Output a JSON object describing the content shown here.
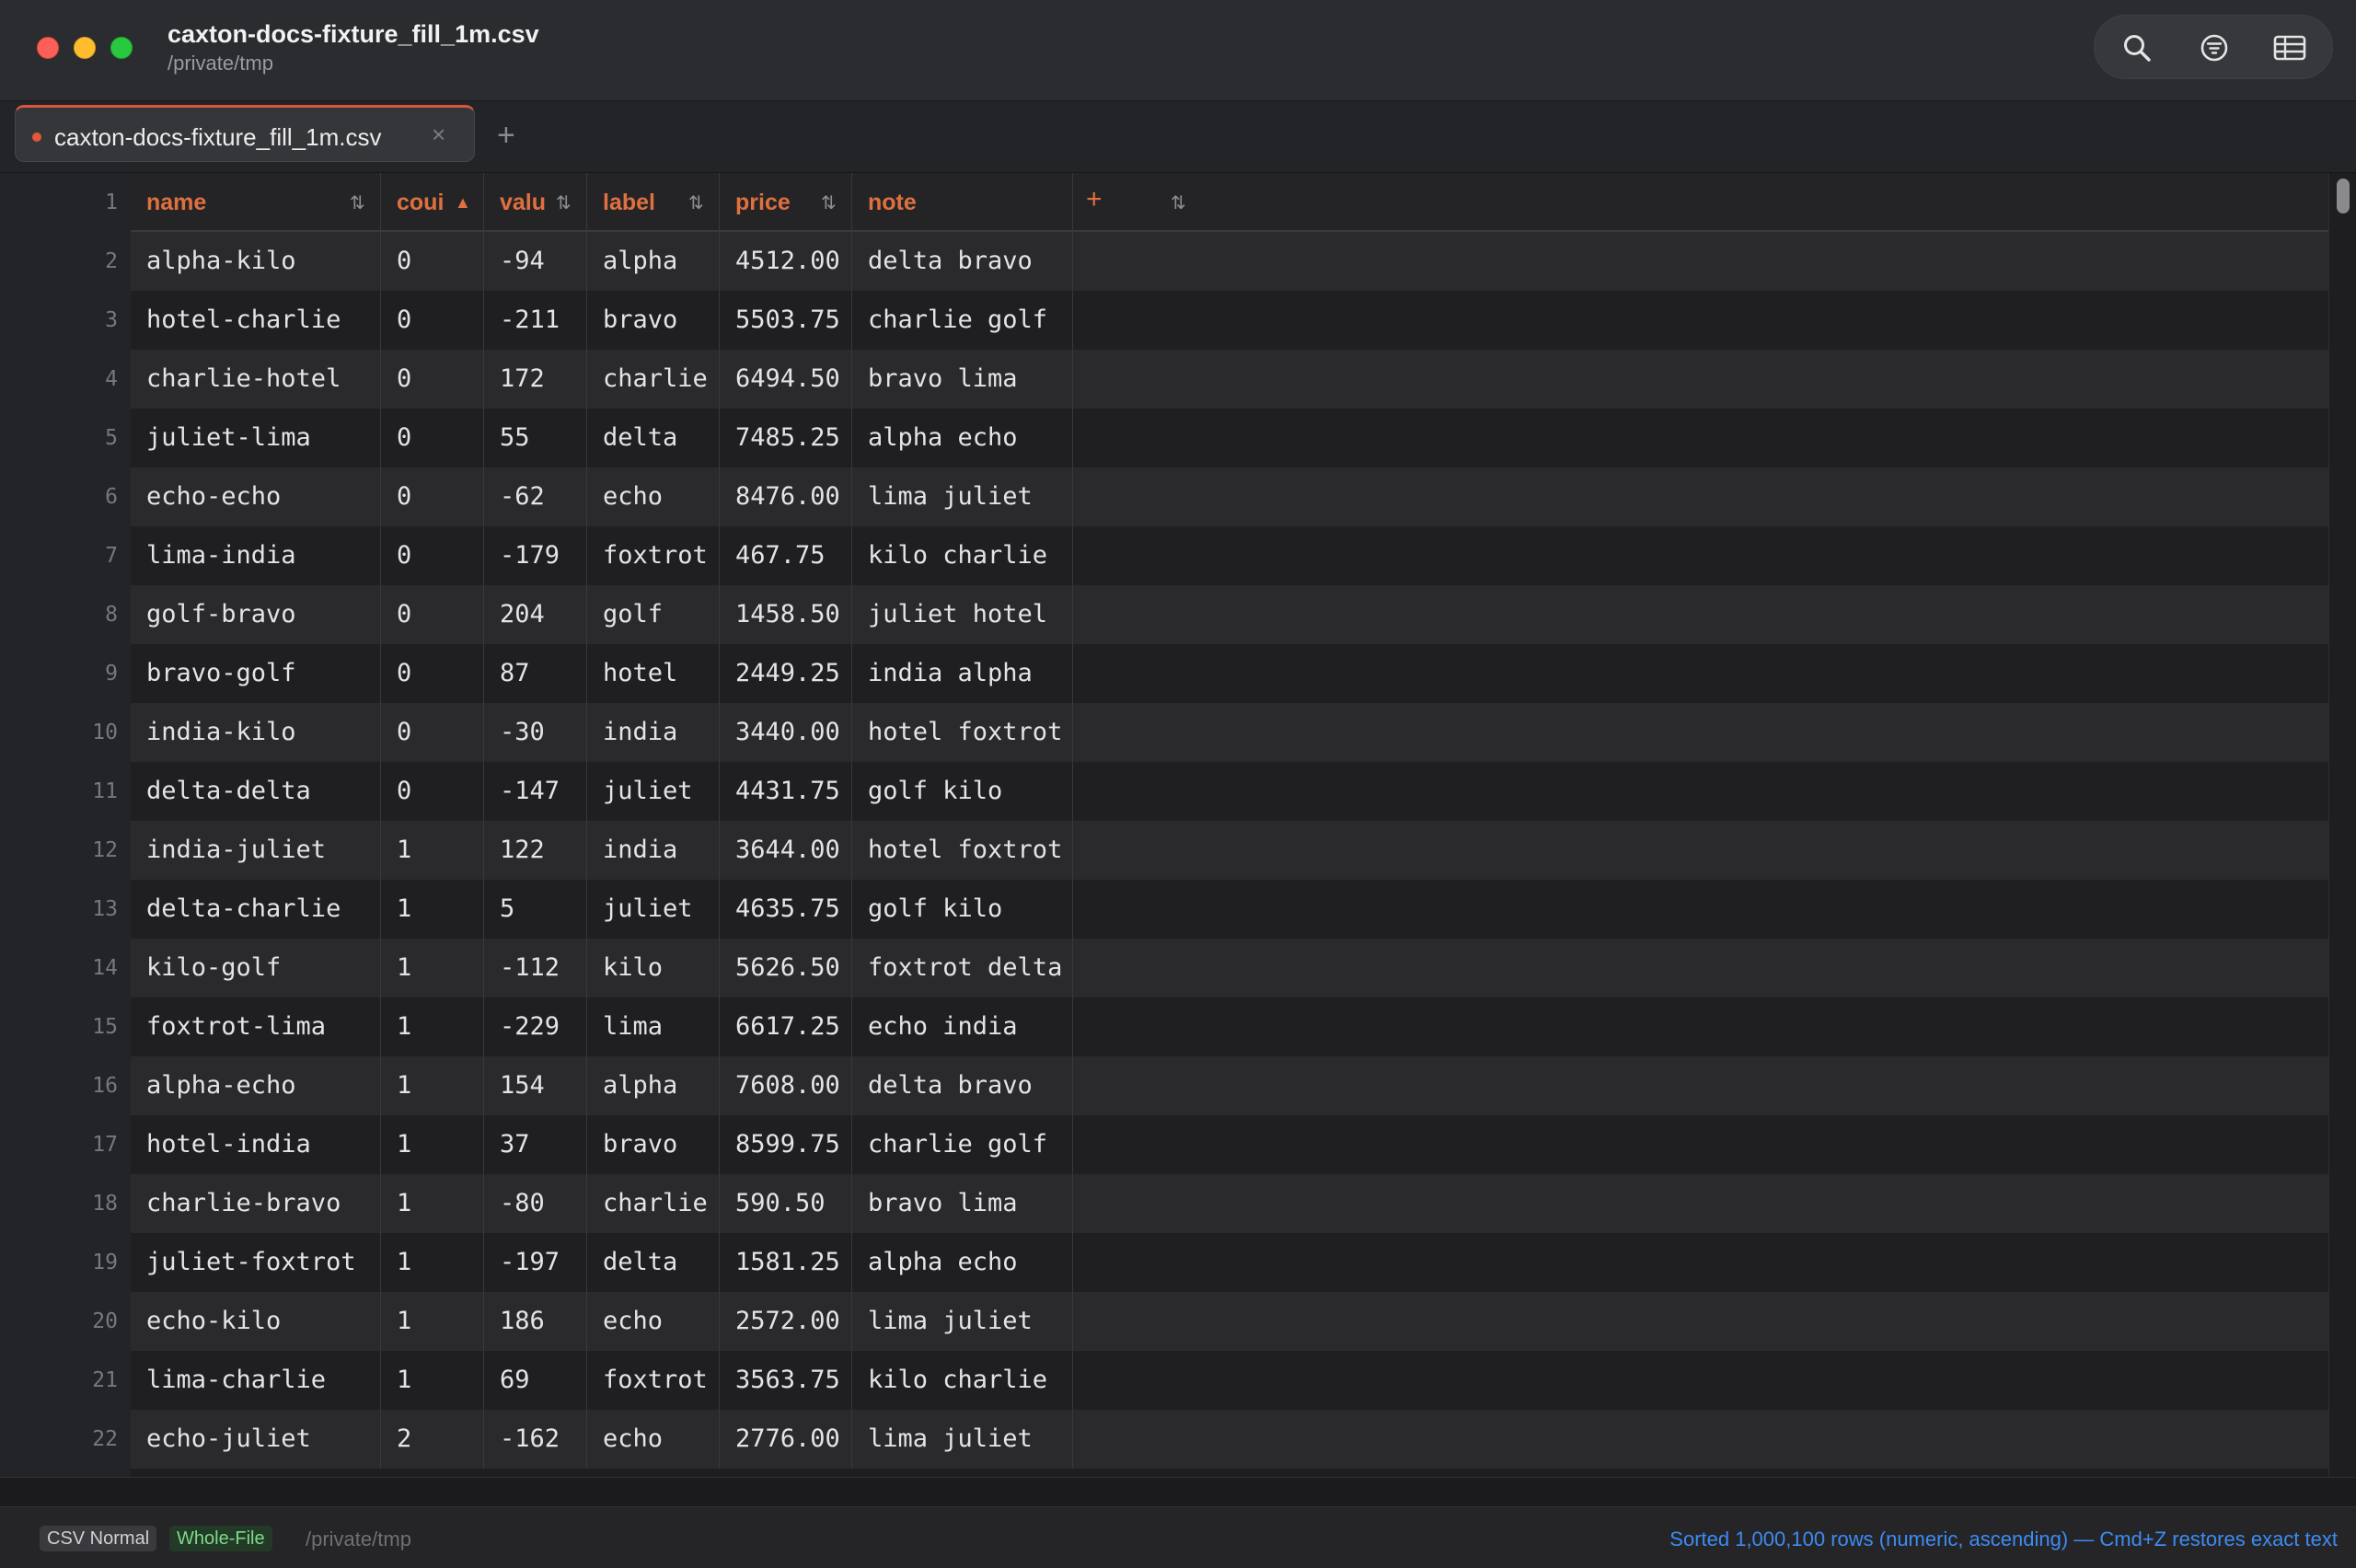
{
  "window": {
    "title": "caxton-docs-fixture_fill_1m.csv",
    "subtitle": "/private/tmp"
  },
  "toolbar": {
    "search_icon": "search-icon",
    "filter_icon": "filter-icon",
    "grid_icon": "table-grid-icon"
  },
  "tabs": [
    {
      "label": "caxton-docs-fixture_fill_1m.csv",
      "close": "×",
      "modified": true
    }
  ],
  "tab_add": "+",
  "column_add": "+",
  "columns": [
    {
      "label": "name",
      "sort": "⇅"
    },
    {
      "label": "coui",
      "sort": "▲"
    },
    {
      "label": "valu",
      "sort": "⇅"
    },
    {
      "label": "label",
      "sort": "⇅"
    },
    {
      "label": "price",
      "sort": "⇅"
    },
    {
      "label": "note",
      "sort": "⇅"
    }
  ],
  "header_row_number": "1",
  "rows": [
    {
      "n": "2",
      "cells": [
        "alpha-kilo",
        "0",
        "-94",
        "alpha",
        "4512.00",
        "delta bravo"
      ]
    },
    {
      "n": "3",
      "cells": [
        "hotel-charlie",
        "0",
        "-211",
        "bravo",
        "5503.75",
        "charlie golf"
      ]
    },
    {
      "n": "4",
      "cells": [
        "charlie-hotel",
        "0",
        "172",
        "charlie",
        "6494.50",
        "bravo lima"
      ]
    },
    {
      "n": "5",
      "cells": [
        "juliet-lima",
        "0",
        "55",
        "delta",
        "7485.25",
        "alpha echo"
      ]
    },
    {
      "n": "6",
      "cells": [
        "echo-echo",
        "0",
        "-62",
        "echo",
        "8476.00",
        "lima juliet"
      ]
    },
    {
      "n": "7",
      "cells": [
        "lima-india",
        "0",
        "-179",
        "foxtrot",
        "467.75",
        "kilo charlie"
      ]
    },
    {
      "n": "8",
      "cells": [
        "golf-bravo",
        "0",
        "204",
        "golf",
        "1458.50",
        "juliet hotel"
      ]
    },
    {
      "n": "9",
      "cells": [
        "bravo-golf",
        "0",
        "87",
        "hotel",
        "2449.25",
        "india alpha"
      ]
    },
    {
      "n": "10",
      "cells": [
        "india-kilo",
        "0",
        "-30",
        "india",
        "3440.00",
        "hotel foxtrot"
      ]
    },
    {
      "n": "11",
      "cells": [
        "delta-delta",
        "0",
        "-147",
        "juliet",
        "4431.75",
        "golf kilo"
      ]
    },
    {
      "n": "12",
      "cells": [
        "india-juliet",
        "1",
        "122",
        "india",
        "3644.00",
        "hotel foxtrot"
      ]
    },
    {
      "n": "13",
      "cells": [
        "delta-charlie",
        "1",
        "5",
        "juliet",
        "4635.75",
        "golf kilo"
      ]
    },
    {
      "n": "14",
      "cells": [
        "kilo-golf",
        "1",
        "-112",
        "kilo",
        "5626.50",
        "foxtrot delta"
      ]
    },
    {
      "n": "15",
      "cells": [
        "foxtrot-lima",
        "1",
        "-229",
        "lima",
        "6617.25",
        "echo india"
      ]
    },
    {
      "n": "16",
      "cells": [
        "alpha-echo",
        "1",
        "154",
        "alpha",
        "7608.00",
        "delta bravo"
      ]
    },
    {
      "n": "17",
      "cells": [
        "hotel-india",
        "1",
        "37",
        "bravo",
        "8599.75",
        "charlie golf"
      ]
    },
    {
      "n": "18",
      "cells": [
        "charlie-bravo",
        "1",
        "-80",
        "charlie",
        "590.50",
        "bravo lima"
      ]
    },
    {
      "n": "19",
      "cells": [
        "juliet-foxtrot",
        "1",
        "-197",
        "delta",
        "1581.25",
        "alpha echo"
      ]
    },
    {
      "n": "20",
      "cells": [
        "echo-kilo",
        "1",
        "186",
        "echo",
        "2572.00",
        "lima juliet"
      ]
    },
    {
      "n": "21",
      "cells": [
        "lima-charlie",
        "1",
        "69",
        "foxtrot",
        "3563.75",
        "kilo charlie"
      ]
    },
    {
      "n": "22",
      "cells": [
        "echo-juliet",
        "2",
        "-162",
        "echo",
        "2776.00",
        "lima juliet"
      ]
    }
  ],
  "status": {
    "mode_badge": "CSV Normal",
    "scope_badge": "Whole-File",
    "path": "/private/tmp",
    "message": "Sorted 1,000,100 rows (numeric, ascending) — Cmd+Z restores exact text"
  },
  "colors": {
    "accent": "#e0703f",
    "status_link": "#3d8bf2",
    "scope_badge": "#7fd98a"
  }
}
